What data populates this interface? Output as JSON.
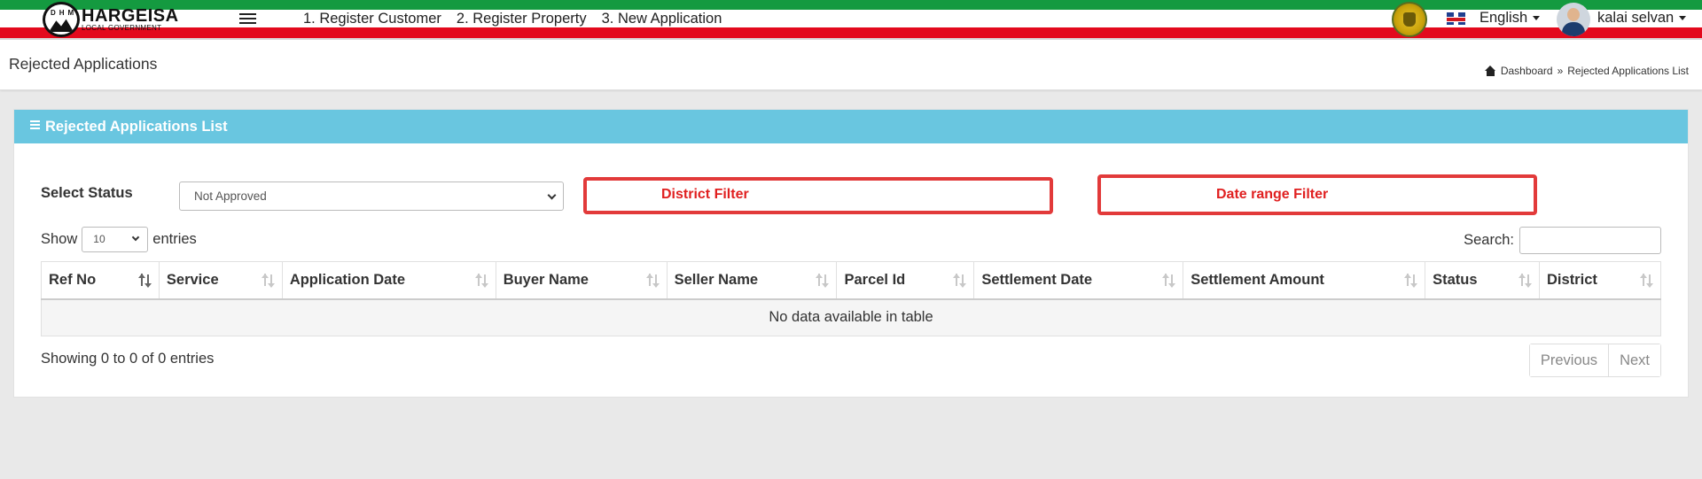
{
  "navbar": {
    "logo_title": "HARGEISA",
    "logo_subtitle": "LOCAL GOVERNMENT",
    "logo_letters": "DHM",
    "links": [
      "1. Register Customer",
      "2. Register Property",
      "3. New Application"
    ],
    "language": "English",
    "user_name": "kalai selvan"
  },
  "page": {
    "title": "Rejected Applications",
    "breadcrumb": [
      "Dashboard",
      "»",
      "Rejected Applications List"
    ]
  },
  "card": {
    "title": "Rejected Applications List",
    "filter_label": "Select Status",
    "status_value": "Not Approved",
    "annotations": {
      "district": "District Filter",
      "date_range": "Date range Filter"
    },
    "show_label": "Show",
    "entries_value": "10",
    "entries_label": "entries",
    "search_label": "Search:",
    "table": {
      "columns": [
        "Ref No",
        "Service",
        "Application Date",
        "Buyer Name",
        "Seller Name",
        "Parcel Id",
        "Settlement Date",
        "Settlement Amount",
        "Status",
        "District"
      ],
      "empty_message": "No data available in table"
    },
    "info": "Showing 0 to 0 of 0 entries",
    "pager": {
      "previous": "Previous",
      "next": "Next"
    }
  },
  "colors": {
    "flag_green": "#149a40",
    "flag_red": "#e30a1d",
    "card_header": "#69c6e0",
    "annotation": "#e23a3a"
  }
}
